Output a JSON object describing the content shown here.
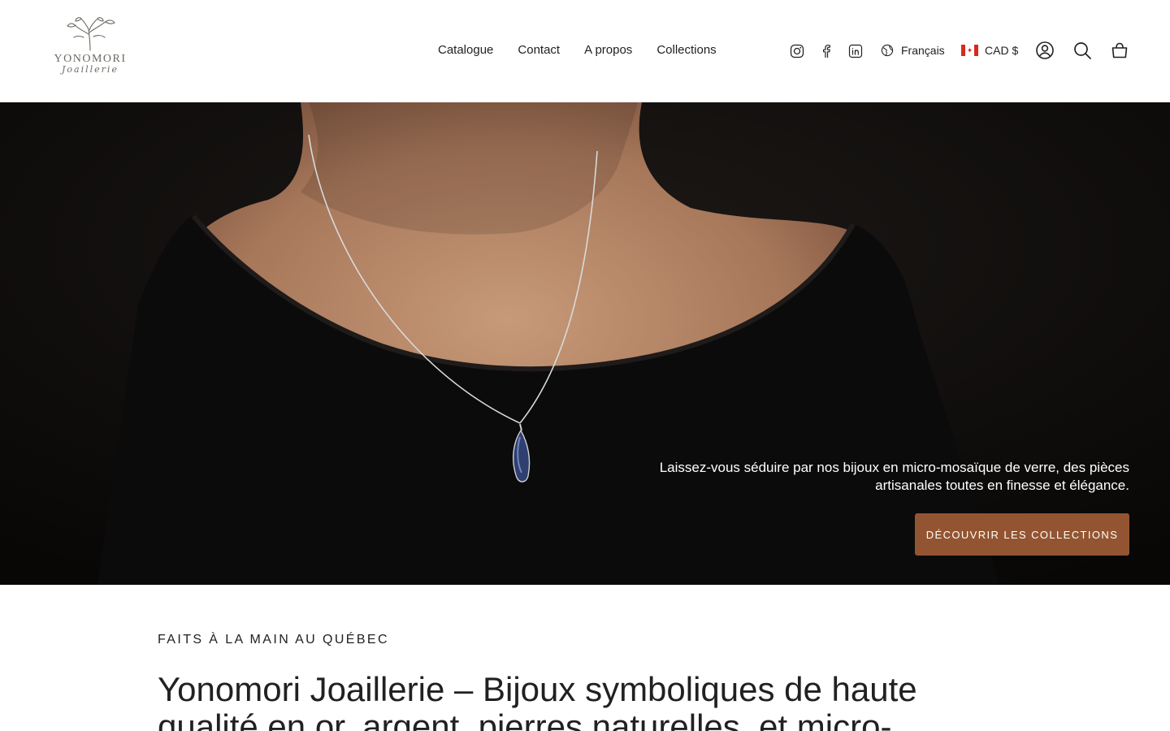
{
  "brand": {
    "name": "YONOMORI",
    "sub": "Joaillerie"
  },
  "nav": {
    "items": [
      {
        "label": "Catalogue"
      },
      {
        "label": "Contact"
      },
      {
        "label": "A propos"
      },
      {
        "label": "Collections"
      }
    ]
  },
  "social": {
    "icons": [
      "instagram-icon",
      "facebook-icon",
      "linkedin-icon"
    ]
  },
  "locale": {
    "language": "Français",
    "currency": "CAD $"
  },
  "utilities": {
    "icons": [
      "account-icon",
      "search-icon",
      "cart-icon"
    ]
  },
  "hero": {
    "text": "Laissez-vous séduire par nos bijoux en micro-mosaïque de verre, des pièces artisanales toutes en finesse et élégance.",
    "button_label": "Découvrir les collections",
    "button_color": "#935531"
  },
  "intro": {
    "eyebrow": "FAITS À LA MAIN AU QUÉBEC",
    "headline": "Yonomori Joaillerie – Bijoux symboliques de haute qualité en or, argent, pierres naturelles, et micro-"
  }
}
